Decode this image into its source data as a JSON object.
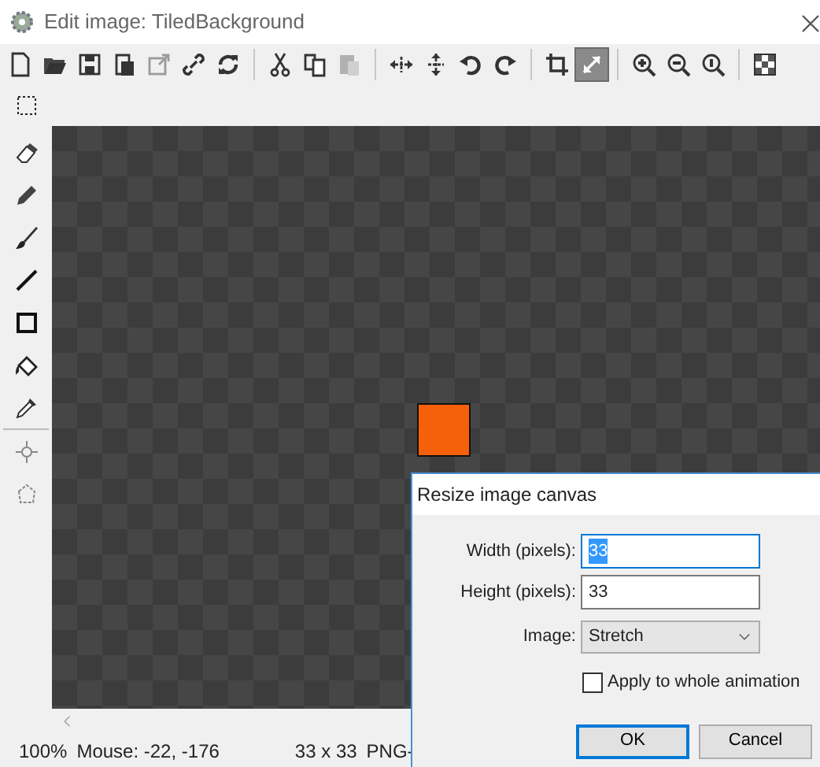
{
  "window": {
    "title": "Edit image: TiledBackground"
  },
  "toolbar_groups": [
    {
      "buttons": [
        {
          "disabled": false,
          "selected": false
        },
        {
          "disabled": false,
          "selected": false
        },
        {
          "disabled": false,
          "selected": false
        },
        {
          "disabled": false,
          "selected": false
        },
        {
          "disabled": true,
          "selected": false
        },
        {
          "disabled": false,
          "selected": false
        },
        {
          "disabled": false,
          "selected": false
        }
      ]
    },
    {
      "buttons": [
        {
          "disabled": false,
          "selected": false
        },
        {
          "disabled": false,
          "selected": false
        },
        {
          "disabled": true,
          "selected": false
        }
      ]
    },
    {
      "buttons": [
        {
          "disabled": false,
          "selected": false
        },
        {
          "disabled": false,
          "selected": false
        },
        {
          "disabled": false,
          "selected": false
        },
        {
          "disabled": false,
          "selected": false
        }
      ]
    },
    {
      "buttons": [
        {
          "disabled": false,
          "selected": false
        },
        {
          "disabled": false,
          "selected": true
        }
      ]
    },
    {
      "buttons": [
        {
          "disabled": false,
          "selected": false
        },
        {
          "disabled": false,
          "selected": false
        },
        {
          "disabled": false,
          "selected": false
        }
      ]
    },
    {
      "buttons": [
        {
          "disabled": false,
          "selected": false
        }
      ]
    }
  ],
  "dialog": {
    "title": "Resize image canvas",
    "fields": [
      {
        "label": "Width (pixels):",
        "value": "33",
        "text_selected": true
      },
      {
        "label": "Height (pixels):",
        "value": "33",
        "text_selected": false
      }
    ],
    "image": {
      "label": "Image:",
      "value": "Stretch"
    },
    "checkbox": {
      "label": "Apply to whole animation",
      "checked": false
    },
    "buttons": [
      {
        "label": "OK",
        "default": true
      },
      {
        "label": "Cancel",
        "default": false
      }
    ]
  },
  "status_bar": {
    "zoom": "100%",
    "mouse": "Mouse: -22, -176",
    "size": "33 x 33",
    "format": "PNG-"
  }
}
